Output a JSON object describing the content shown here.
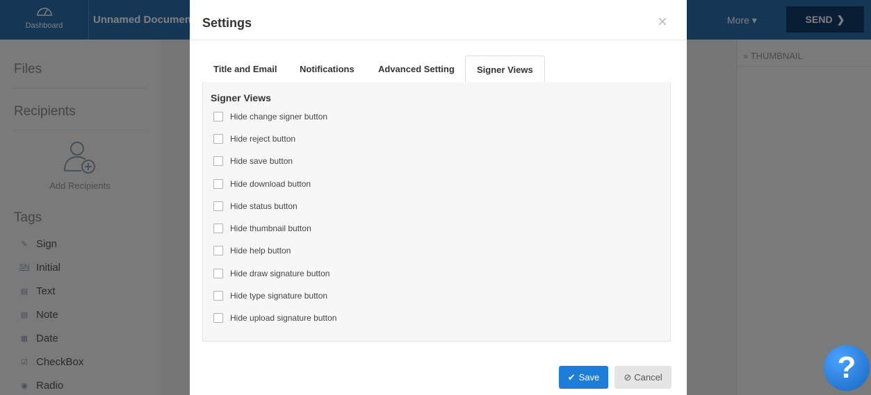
{
  "app": {
    "dashboard_label": "Dashboard",
    "document_title": "Unnamed Document",
    "more_label": "More",
    "send_label": "SEND",
    "thumbnail_label": "THUMBNAIL"
  },
  "left_panel": {
    "files_heading": "Files",
    "recipients_heading": "Recipients",
    "add_recipients_label": "Add Recipients",
    "tags_heading": "Tags",
    "tags": [
      {
        "label": "Sign",
        "icon": "pen-icon"
      },
      {
        "label": "Initial",
        "icon": "initial-icon",
        "icon_text": "SN"
      },
      {
        "label": "Text",
        "icon": "text-icon"
      },
      {
        "label": "Note",
        "icon": "note-icon"
      },
      {
        "label": "Date",
        "icon": "calendar-icon"
      },
      {
        "label": "CheckBox",
        "icon": "checkbox-icon"
      },
      {
        "label": "Radio",
        "icon": "radio-icon"
      }
    ]
  },
  "modal": {
    "title": "Settings",
    "close_glyph": "×",
    "tabs": [
      {
        "label": "Title and Email",
        "active": false
      },
      {
        "label": "Notifications",
        "active": false
      },
      {
        "label": "Advanced Setting",
        "active": false
      },
      {
        "label": "Signer Views",
        "active": true
      }
    ],
    "section_title": "Signer Views",
    "options": [
      {
        "label": "Hide change signer button",
        "checked": false
      },
      {
        "label": "Hide reject button",
        "checked": false
      },
      {
        "label": "Hide save button",
        "checked": false
      },
      {
        "label": "Hide download button",
        "checked": false
      },
      {
        "label": "Hide status button",
        "checked": false
      },
      {
        "label": "Hide thumbnail button",
        "checked": false
      },
      {
        "label": "Hide help button",
        "checked": false
      },
      {
        "label": "Hide draw signature button",
        "checked": false
      },
      {
        "label": "Hide type signature button",
        "checked": false
      },
      {
        "label": "Hide upload signature button",
        "checked": false
      }
    ],
    "save_label": "Save",
    "cancel_label": "Cancel"
  },
  "help_glyph": "?",
  "colors": {
    "topbar": "#2b6cab",
    "send_button": "#123a6b",
    "save_button": "#1c7ed6",
    "cancel_button": "#e5e5e5"
  }
}
